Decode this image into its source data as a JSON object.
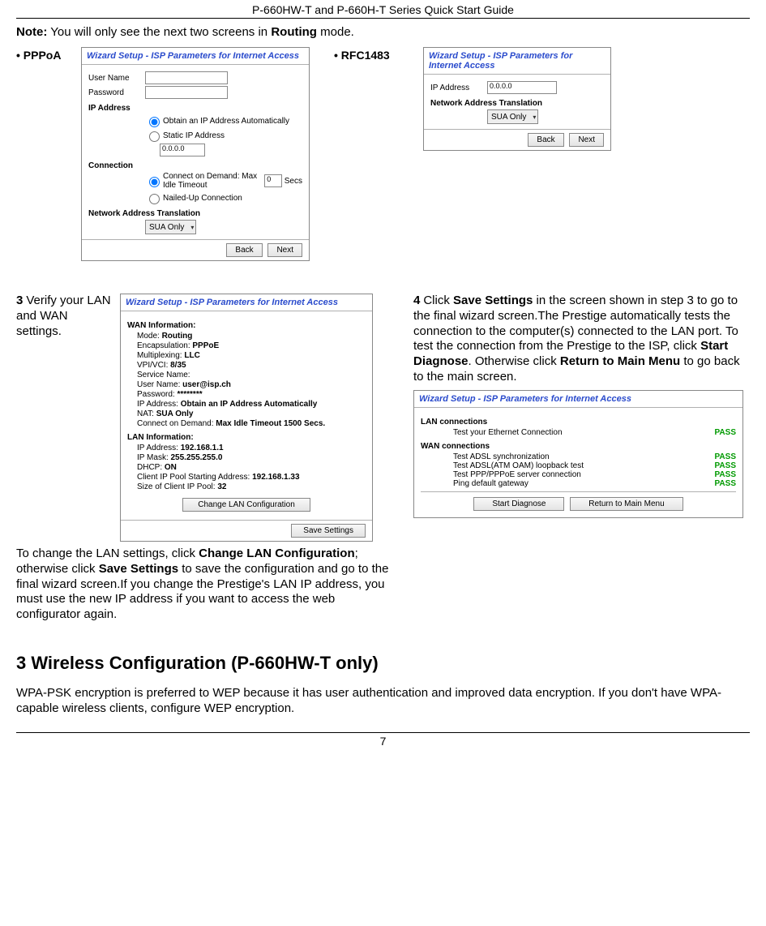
{
  "header": "P-660HW-T and P-660H-T Series Quick Start Guide",
  "note_prefix": "Note:",
  "note_body_a": " You will only see the next two screens in ",
  "note_bold": "Routing",
  "note_body_b": " mode.",
  "bullets": {
    "pppoa": "PPPoA",
    "rfc": "RFC1483"
  },
  "wizard_title": "Wizard Setup - ISP Parameters for Internet Access",
  "pppoa_panel": {
    "user_name": "User Name",
    "password": "Password",
    "ip_addr_head": "IP Address",
    "obtain": "Obtain an IP Address Automatically",
    "static": "Static IP Address",
    "static_val": "0.0.0.0",
    "conn_head": "Connection",
    "cod": "Connect on Demand: Max Idle Timeout",
    "cod_val": "0",
    "cod_secs": "Secs",
    "nailed": "Nailed-Up Connection",
    "nat_head": "Network Address Translation",
    "nat_val": "SUA Only",
    "back": "Back",
    "next": "Next"
  },
  "rfc_panel": {
    "ip_label": "IP Address",
    "ip_val": "0.0.0.0",
    "nat_head": "Network Address Translation",
    "nat_val": "SUA Only",
    "back": "Back",
    "next": "Next"
  },
  "step3": {
    "num": "3",
    "text": "Verify your LAN and WAN settings.",
    "para_a": "To change the LAN settings, click ",
    "para_b": "Change LAN Configuration",
    "para_c": "; otherwise click ",
    "para_d": "Save Settings",
    "para_e": " to save the configuration and go to the final wizard screen.If you change the Prestige's LAN IP address, you must use the new IP address if you want to access the web configurator again."
  },
  "summary_panel": {
    "wan_head": "WAN Information:",
    "mode": "Mode: ",
    "mode_v": "Routing",
    "encap": "Encapsulation: ",
    "encap_v": "PPPoE",
    "mux": "Multiplexing: ",
    "mux_v": "LLC",
    "vpi": "VPI/VCI: ",
    "vpi_v": "8/35",
    "svc": "Service Name:",
    "un": "User Name: ",
    "un_v": "user@isp.ch",
    "pw": "Password: ",
    "pw_v": "********",
    "ipa": "IP Address: ",
    "ipa_v": "Obtain an IP Address Automatically",
    "nat": "NAT: ",
    "nat_v": "SUA Only",
    "cod": "Connect on Demand: ",
    "cod_v": "Max Idle Timeout 1500 Secs.",
    "lan_head": "LAN Information:",
    "lip": "IP Address: ",
    "lip_v": "192.168.1.1",
    "lmask": "IP Mask: ",
    "lmask_v": "255.255.255.0",
    "dhcp": "DHCP: ",
    "dhcp_v": "ON",
    "pool": "Client IP Pool Starting Address: ",
    "pool_v": "192.168.1.33",
    "psize": "Size of Client IP Pool: ",
    "psize_v": "32",
    "btn_change": "Change LAN Configuration",
    "btn_save": "Save Settings"
  },
  "step4": {
    "num": "4",
    "a": "Click ",
    "b": "Save Settings",
    "c": " in the screen shown in step 3 to go to the final wizard screen.The Prestige automatically tests the connection to the computer(s) connected to the LAN port. To test the connection from the Prestige to the ISP, click ",
    "d": "Start Diagnose",
    "e": ". Otherwise click ",
    "f": "Return to Main Menu",
    "g": " to go back to the main screen."
  },
  "diag_panel": {
    "lan_head": "LAN connections",
    "lan1": "Test your Ethernet Connection",
    "wan_head": "WAN connections",
    "wan1": "Test ADSL synchronization",
    "wan2": "Test ADSL(ATM OAM) loopback test",
    "wan3": "Test PPP/PPPoE server connection",
    "wan4": "Ping default gateway",
    "pass": "PASS",
    "btn_start": "Start Diagnose",
    "btn_return": "Return to Main Menu"
  },
  "section3_title": "3 Wireless Configuration (P-660HW-T only)",
  "section3_body": "WPA-PSK encryption is preferred to WEP because it has user authentication and improved data encryption. If you don't have WPA-capable wireless clients, configure WEP encryption.",
  "page_num": "7"
}
